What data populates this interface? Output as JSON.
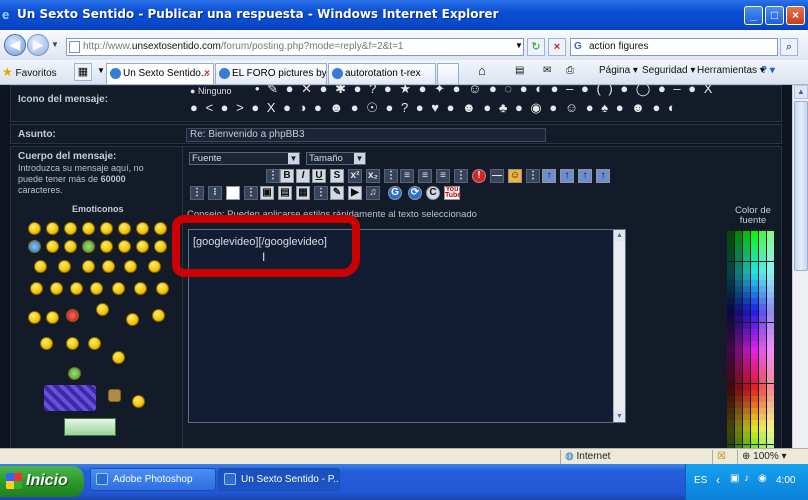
{
  "window": {
    "title": "Un Sexto Sentido - Publicar una respuesta - Windows Internet Explorer"
  },
  "address": {
    "prefix": "http://www.",
    "domain": "unsextosentido.com",
    "path": "/forum/posting.php?mode=reply&f=2&t=1"
  },
  "search": {
    "value": "action figures"
  },
  "favorites_label": "Favoritos",
  "tabs": [
    {
      "label": "Un Sexto Sentido..."
    },
    {
      "label": "EL FORO pictures by ..."
    },
    {
      "label": "autorotation t-rex"
    }
  ],
  "commands": [
    "Página",
    "Seguridad",
    "Herramientas"
  ],
  "form": {
    "icon_label": "Icono del mensaje:",
    "icon_none": "Ninguno",
    "subject_label": "Asunto:",
    "subject_value": "Re: Bienvenido a phpBB3",
    "body_label": "Cuerpo del mensaje:",
    "body_help": "Introduzca su mensaje aquí, no puede tener más de",
    "body_limit": "60000",
    "body_suffix": "caracteres.",
    "emoticons_label": "Emoticonos",
    "font_select": "Fuente",
    "size_select": "Tamaño",
    "hint": "Consejo: Pueden aplicarse estilos rápidamente al texto seleccionado",
    "editor_text": "[googlevideo][/googlevideo]",
    "color_label": "Color de fuente"
  },
  "status": {
    "zone": "Internet",
    "zoom": "100%"
  },
  "taskbar": {
    "start": "Inicio",
    "items": [
      "Adobe Photoshop",
      "Un Sexto Sentido - P..."
    ],
    "lang": "ES",
    "clock": "4:00"
  }
}
